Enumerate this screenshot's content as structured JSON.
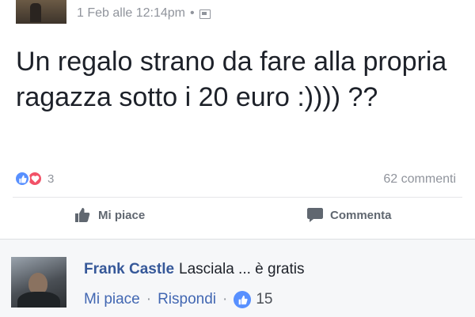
{
  "post": {
    "timestamp": "1 Feb alle 12:14pm",
    "separator": "•",
    "audience_icon": "friends-icon",
    "text": "Un regalo strano da fare alla propria ragazza sotto i 20 euro :)))) ??",
    "reactions": {
      "icons": [
        "like-icon",
        "love-icon"
      ],
      "count": "3"
    },
    "comments_count": "62 commenti",
    "actions": {
      "like": "Mi piace",
      "comment": "Commenta"
    }
  },
  "comment": {
    "author": "Frank Castle",
    "text": "Lasciala ... è gratis",
    "like_label": "Mi piace",
    "separator": "·",
    "reply_label": "Rispondi",
    "like_count": "15"
  },
  "colors": {
    "text": "#1d2129",
    "meta": "#90949c",
    "link": "#4267b2",
    "author": "#365899",
    "like_blue": "#5890ff",
    "love_red": "#f25268"
  }
}
